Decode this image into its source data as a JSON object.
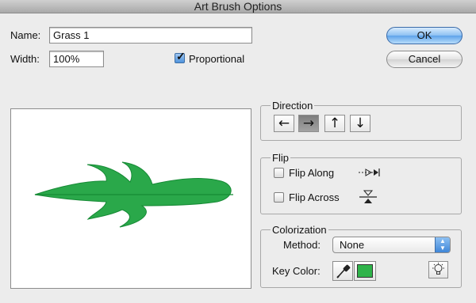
{
  "window": {
    "title": "Art Brush Options"
  },
  "fields": {
    "name_label": "Name:",
    "name_value": "Grass 1",
    "width_label": "Width:",
    "width_value": "100%",
    "proportional_label": "Proportional",
    "proportional_checked": true
  },
  "buttons": {
    "ok_label": "OK",
    "cancel_label": "Cancel"
  },
  "direction": {
    "title": "Direction",
    "buttons": [
      {
        "glyph": "←",
        "icon": "arrow-left-icon",
        "active": false
      },
      {
        "glyph": "→",
        "icon": "arrow-right-icon",
        "active": true
      },
      {
        "glyph": "↑",
        "icon": "arrow-up-icon",
        "active": false
      },
      {
        "glyph": "↓",
        "icon": "arrow-down-icon",
        "active": false
      }
    ]
  },
  "flip": {
    "title": "Flip",
    "along_label": "Flip Along",
    "along_checked": false,
    "across_label": "Flip Across",
    "across_checked": false
  },
  "colorization": {
    "title": "Colorization",
    "method_label": "Method:",
    "method_value": "None",
    "key_color_label": "Key Color:",
    "key_color": "#2fb34a"
  },
  "preview": {
    "brush_color": "#2aa84a",
    "brush_stroke": "#168a35"
  }
}
